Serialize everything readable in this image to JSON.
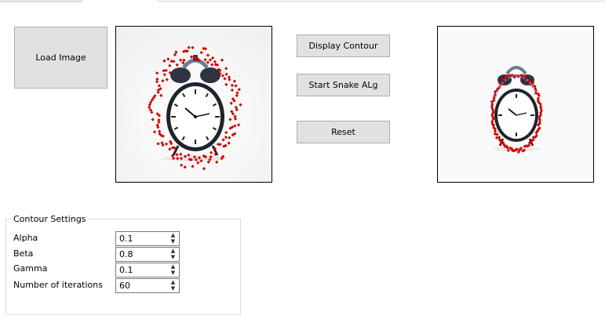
{
  "buttons": {
    "load_image": "Load Image",
    "display_contour": "Display Contour",
    "start_snake": "Start Snake ALg",
    "reset": "Reset"
  },
  "contour_settings": {
    "title": "Contour Settings",
    "rows": [
      {
        "label": "Alpha",
        "value": "0.1"
      },
      {
        "label": "Beta",
        "value": "0.8"
      },
      {
        "label": "Gamma",
        "value": "0.1"
      },
      {
        "label": "Number of iterations",
        "value": "60"
      }
    ]
  },
  "colors": {
    "contour_points": "#d00000",
    "snake_points": "#6a86b8",
    "button_bg": "#e1e1e1"
  },
  "icons": {
    "spin_up": "caret-up-icon",
    "spin_down": "caret-down-icon"
  }
}
